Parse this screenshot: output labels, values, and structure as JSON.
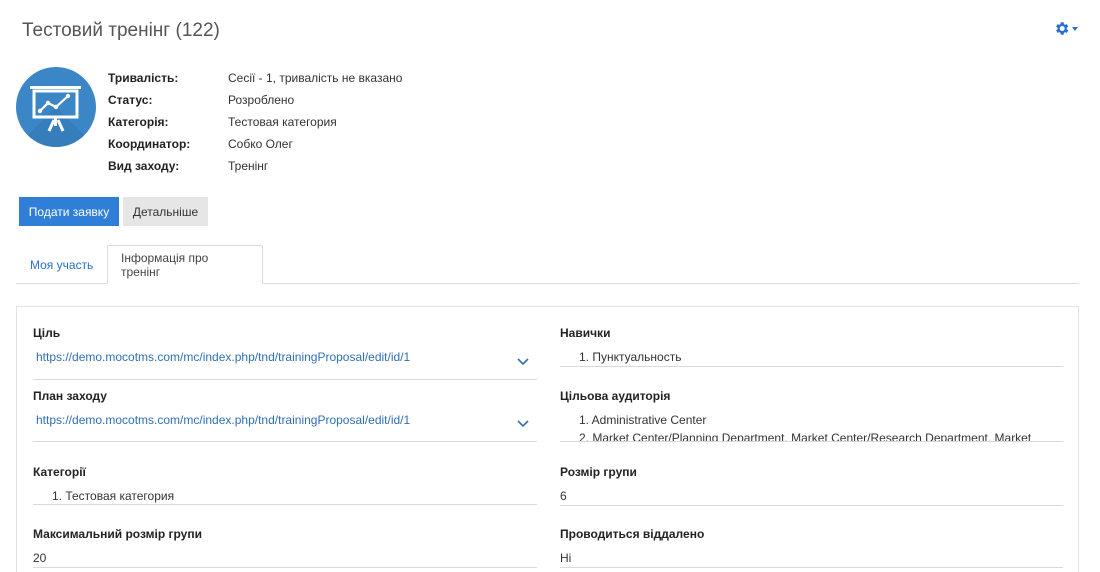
{
  "header": {
    "title": "Тестовий тренінг (122)"
  },
  "meta": [
    {
      "label": "Тривалість:",
      "value": "Сесії - 1, тривалість не вказано"
    },
    {
      "label": "Статус:",
      "value": "Розроблено"
    },
    {
      "label": "Категорія:",
      "value": "Тестовая категория"
    },
    {
      "label": "Координатор:",
      "value": "Собко Олег"
    },
    {
      "label": "Вид заходу:",
      "value": "Тренінг"
    }
  ],
  "actions": {
    "apply_label": "Подати заявку",
    "details_label": "Детальніше"
  },
  "tabs": {
    "my_participation": "Моя участь",
    "training_info": "Інформація про тренінг",
    "active": "training_info"
  },
  "fields": {
    "goal": {
      "label": "Ціль",
      "value": "https://demo.mocotms.com/mc/index.php/tnd/trainingProposal/edit/id/1"
    },
    "plan": {
      "label": "План заходу",
      "value": "https://demo.mocotms.com/mc/index.php/tnd/trainingProposal/edit/id/1"
    },
    "categories": {
      "label": "Категорії",
      "items": [
        "1. Тестовая категория"
      ]
    },
    "max_group_size": {
      "label": "Максимальний розмір групи",
      "value": "20"
    },
    "skills": {
      "label": "Навички",
      "items": [
        "1. Пунктуальность"
      ]
    },
    "audience": {
      "label": "Цільова аудиторія",
      "items": [
        "1. Administrative Center",
        "2. Market Center/Planning Department, Market Center/Research Department, Market"
      ]
    },
    "group_size": {
      "label": "Розмір групи",
      "value": "6"
    },
    "remote": {
      "label": "Проводиться віддалено",
      "value": "Ні"
    }
  },
  "colors": {
    "accent": "#2f7ed8",
    "link": "#2f6fb5",
    "icon_bg": "#3a86c6"
  }
}
